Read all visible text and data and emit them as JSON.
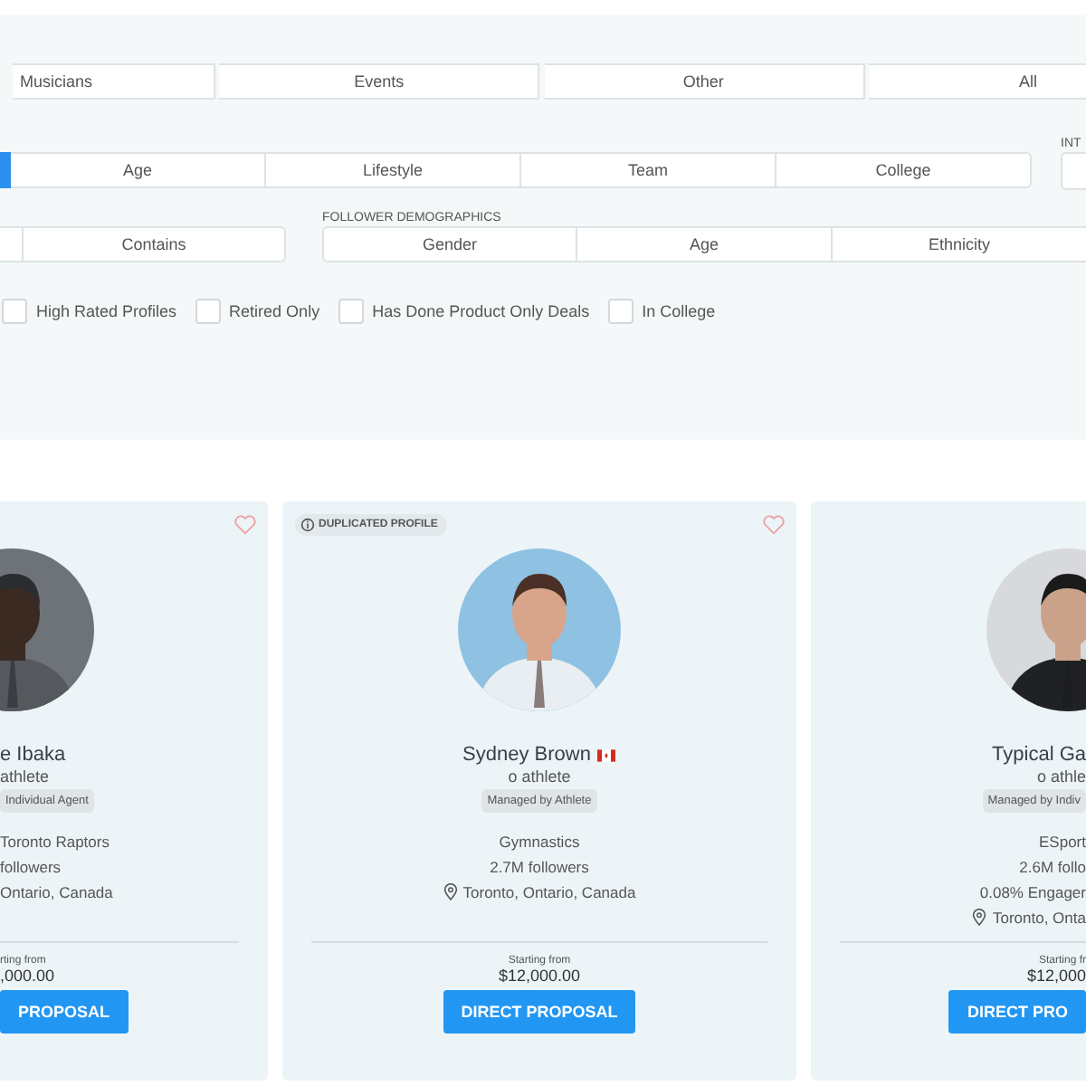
{
  "category_tabs": [
    {
      "label": "Musicians",
      "selected": false
    },
    {
      "label": "Events",
      "selected": false
    },
    {
      "label": "Other",
      "selected": false
    },
    {
      "label": "All",
      "selected": false
    }
  ],
  "filter_tabs": [
    {
      "selected": true
    },
    {
      "label": "Age",
      "selected": false
    },
    {
      "label": "Lifestyle",
      "selected": false
    },
    {
      "label": "Team",
      "selected": false
    },
    {
      "label": "College",
      "selected": false
    }
  ],
  "interests": {
    "label": "INT"
  },
  "match_tabs": [
    {
      "selected": false
    },
    {
      "label": "Contains",
      "selected": false
    }
  ],
  "follower_demographics": {
    "label": "FOLLOWER DEMOGRAPHICS",
    "tabs": [
      {
        "label": "Gender",
        "selected": false
      },
      {
        "label": "Age",
        "selected": false
      },
      {
        "label": "Ethnicity",
        "selected": false
      }
    ]
  },
  "checkboxes": [
    {
      "label": "High Rated Profiles",
      "checked": false
    },
    {
      "label": "Retired Only",
      "checked": false
    },
    {
      "label": "Has Done Product Only Deals",
      "checked": false
    },
    {
      "label": "In College",
      "checked": false
    }
  ],
  "profiles": [
    {
      "name": "e Ibaka",
      "flag": false,
      "type": "athlete",
      "manager": "Individual Agent",
      "favorite": false,
      "lines": [
        "Toronto Raptors",
        "followers"
      ],
      "pin": false,
      "location": "Ontario,  Canada",
      "price_label": "rting from",
      "price": ",000.00",
      "button": "PROPOSAL"
    },
    {
      "name": "Sydney Brown",
      "flag": true,
      "type": "o athlete",
      "manager": "Managed by Athlete",
      "duplicated": "DUPLICATED PROFILE",
      "favorite": false,
      "lines": [
        "Gymnastics",
        "2.7M followers"
      ],
      "pin": true,
      "location": "Toronto,  Ontario,  Canada",
      "price_label": "Starting from",
      "price": "$12,000.00",
      "button": "DIRECT PROPOSAL"
    },
    {
      "name": "Typical Ga",
      "flag": false,
      "type": "o athle",
      "manager": "Managed by Indiv",
      "lines": [
        "ESport",
        "2.6M follo",
        "0.08% Engager"
      ],
      "pin": true,
      "location": "Toronto,  Onta",
      "price_label": "Starting fr",
      "price": "$12,000",
      "button": "DIRECT PRO"
    }
  ]
}
